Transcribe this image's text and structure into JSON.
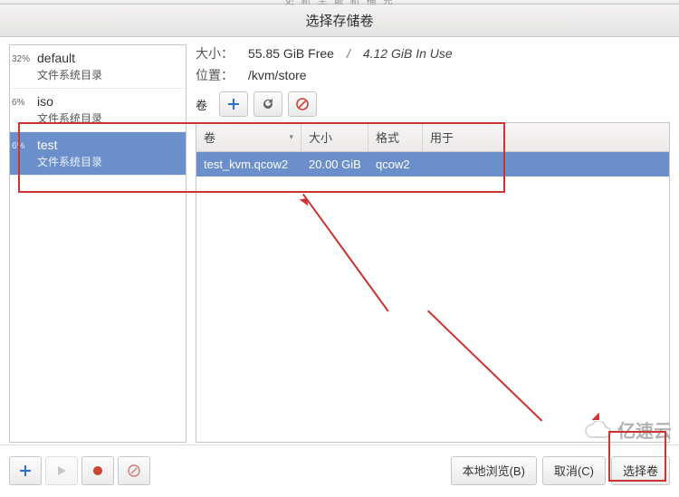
{
  "window": {
    "title": "选择存储卷",
    "blurred_parent": "更 新 至 最 新 補 充"
  },
  "pools": [
    {
      "pct": "32%",
      "name": "default",
      "type": "文件系统目录",
      "selected": false
    },
    {
      "pct": "6%",
      "name": "iso",
      "type": "文件系统目录",
      "selected": false
    },
    {
      "pct": "6%",
      "name": "test",
      "type": "文件系统目录",
      "selected": true
    }
  ],
  "info": {
    "size_label": "大小：",
    "free": "55.85 GiB Free",
    "sep": "/",
    "inuse": "4.12 GiB In Use",
    "loc_label": "位置：",
    "loc_value": "/kvm/store",
    "vol_label": "卷"
  },
  "toolbar_icons": {
    "add": "plus-icon",
    "refresh": "refresh-icon",
    "stop": "stop-circle-icon"
  },
  "columns": {
    "vol": "卷",
    "size": "大小",
    "fmt": "格式",
    "used": "用于"
  },
  "rows": [
    {
      "vol": "test_kvm.qcow2",
      "size": "20.00 GiB",
      "fmt": "qcow2",
      "used": ""
    }
  ],
  "bottom_icons": {
    "add": "plus-icon",
    "play": "play-icon",
    "record": "record-icon",
    "delete": "delete-circle-icon"
  },
  "buttons": {
    "browse": "本地浏览(B)",
    "cancel": "取消(C)",
    "select": "选择卷"
  },
  "watermark": "亿速云"
}
